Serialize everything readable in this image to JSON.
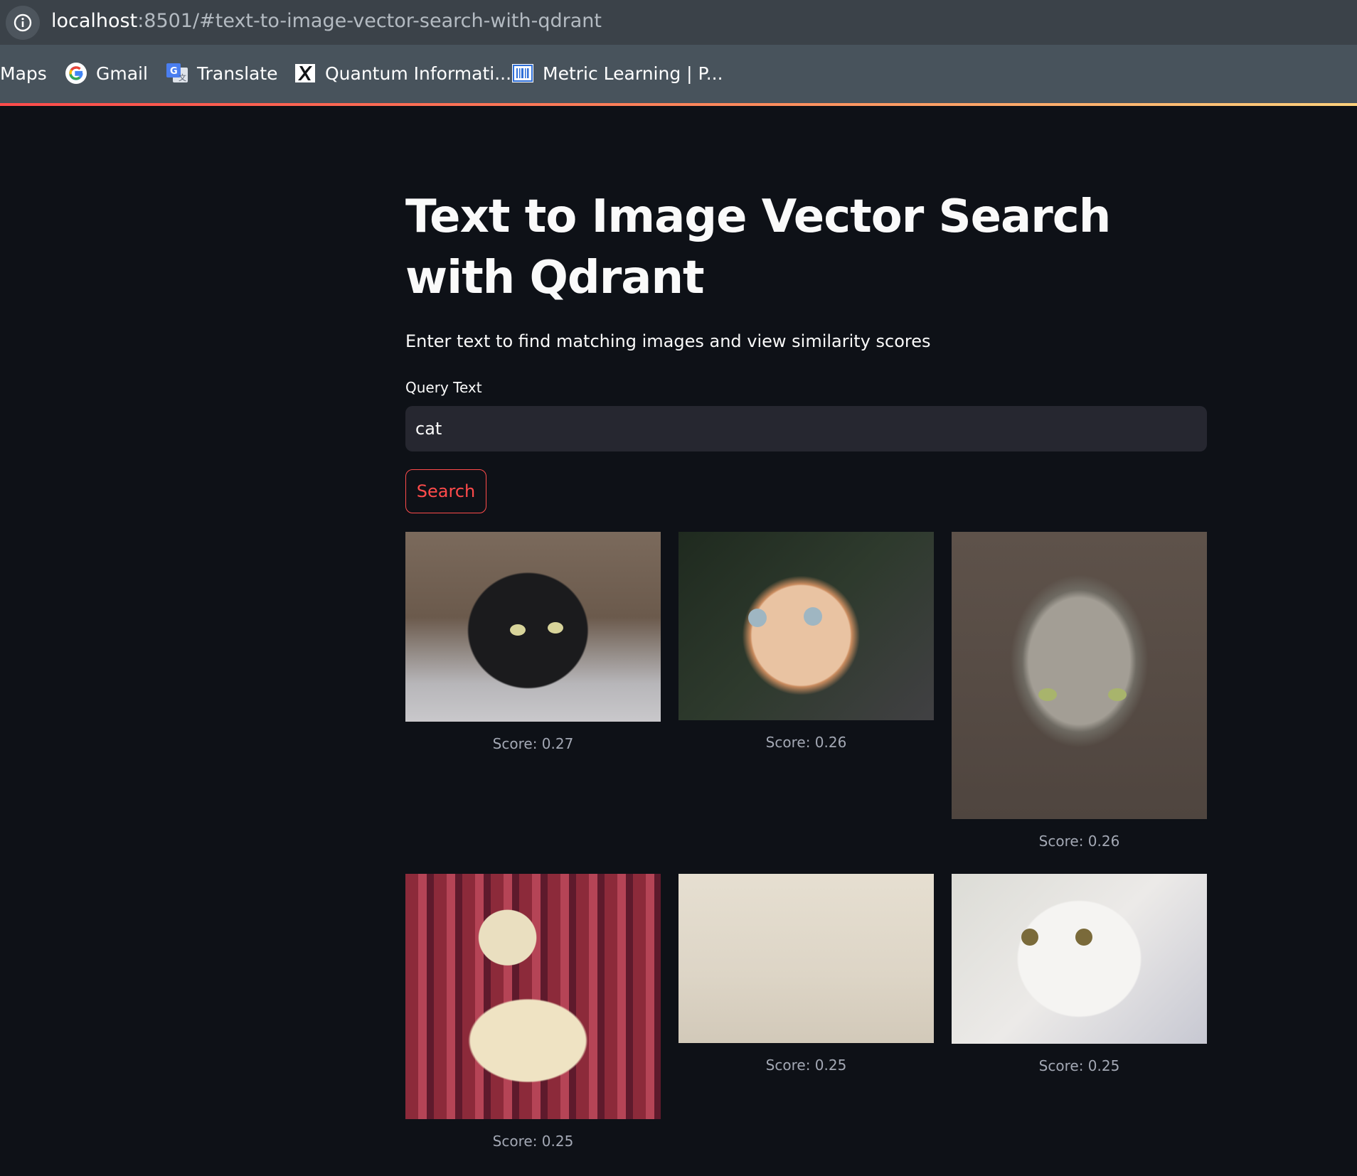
{
  "browser": {
    "url_host": "localhost",
    "url_rest": ":8501/#text-to-image-vector-search-with-qdrant",
    "bookmarks": [
      {
        "label": "Maps",
        "icon": "maps-icon"
      },
      {
        "label": "Gmail",
        "icon": "google-icon"
      },
      {
        "label": "Translate",
        "icon": "translate-icon"
      },
      {
        "label": "Quantum Informati...",
        "icon": "x-icon"
      },
      {
        "label": "Metric Learning | P...",
        "icon": "barcode-icon"
      }
    ]
  },
  "app": {
    "title": "Text to Image Vector Search with Qdrant",
    "subtitle": "Enter text to find matching images and view similarity scores",
    "query_label": "Query Text",
    "query_value": "cat",
    "search_label": "Search",
    "accent_color": "#ff4b4b",
    "results": [
      {
        "caption": "Score: 0.27",
        "image": "black cat"
      },
      {
        "caption": "Score: 0.26",
        "image": "orange and white kitten"
      },
      {
        "caption": "Score: 0.26",
        "image": "grey tabby cat"
      },
      {
        "caption": "Score: 0.25",
        "image": "person holding a ferret"
      },
      {
        "caption": "Score: 0.25",
        "image": "plain beige surface"
      },
      {
        "caption": "Score: 0.25",
        "image": "white cat"
      }
    ]
  }
}
